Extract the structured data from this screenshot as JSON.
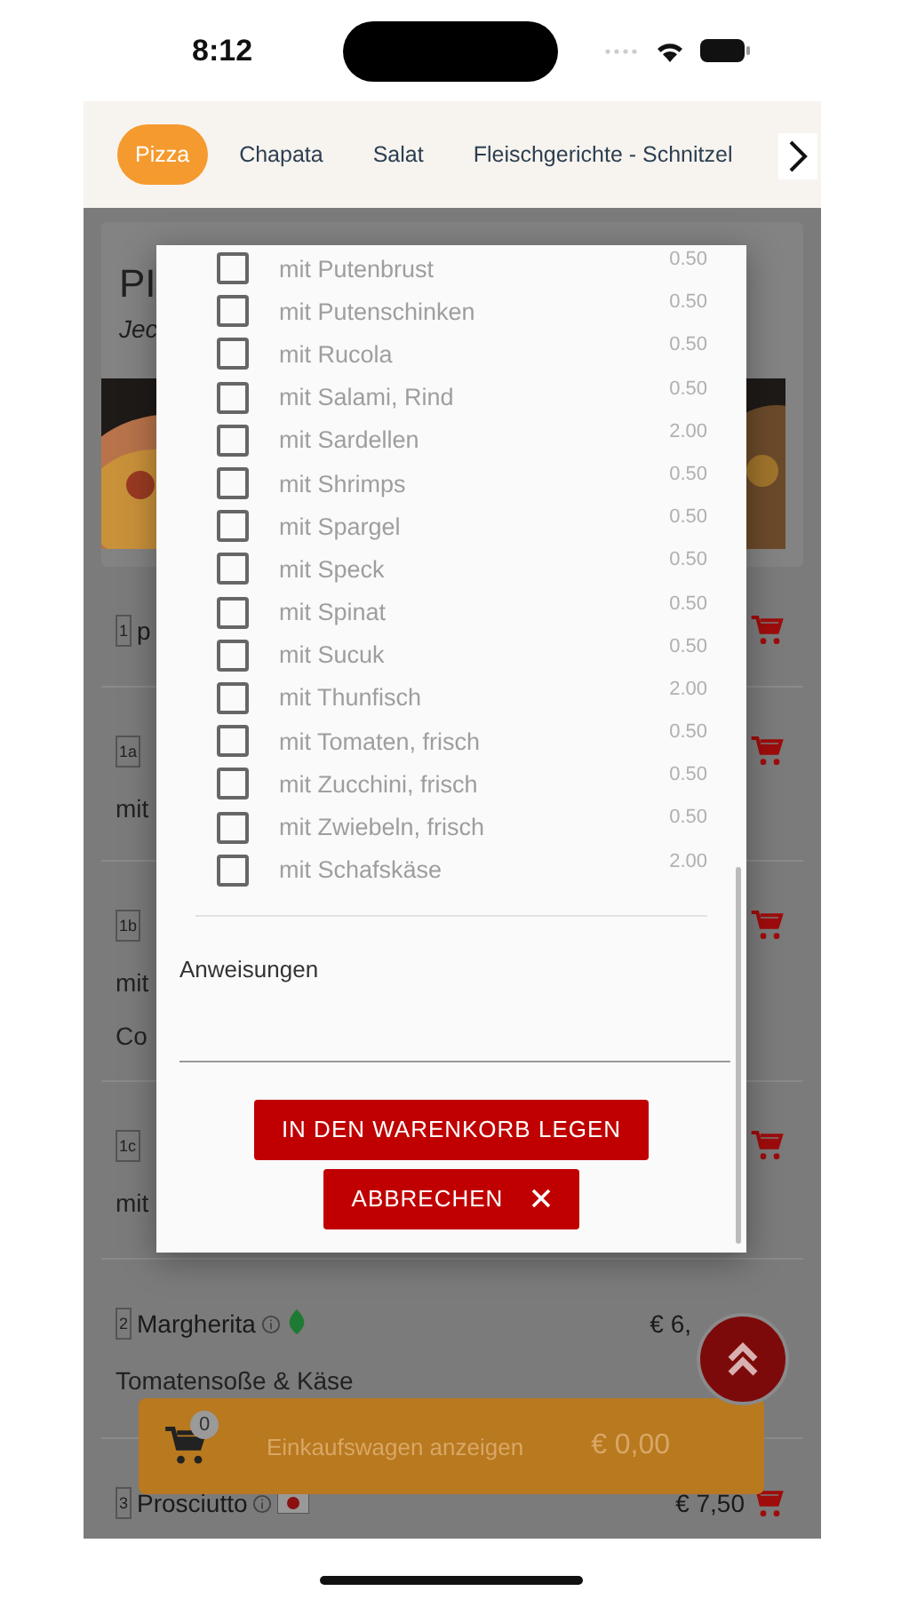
{
  "status_bar": {
    "time": "8:12"
  },
  "tabs": [
    {
      "label": "Pizza",
      "selected": true
    },
    {
      "label": "Chapata",
      "selected": false
    },
    {
      "label": "Salat",
      "selected": false
    },
    {
      "label": "Fleischgerichte - Schnitzel",
      "selected": false
    }
  ],
  "menu": {
    "title": "PI",
    "subtitle": "Jec",
    "items": [
      {
        "code": "1",
        "name": "p",
        "cart": true
      },
      {
        "code": "1a",
        "lines": [
          "mit"
        ],
        "cart": true
      },
      {
        "code": "1b",
        "lines": [
          "mit",
          "Co"
        ],
        "cart": true
      },
      {
        "code": "1c",
        "lines": [
          "mit"
        ],
        "cart": true
      },
      {
        "code": "2",
        "name": "Margherita",
        "price": "€ 6,",
        "lines": [
          "Tomatensoße & Käse"
        ],
        "leaf": true,
        "flag": false,
        "cart": false
      },
      {
        "code": "3",
        "name": "Prosciutto",
        "price": "€ 7,50",
        "leaf": false,
        "flag": true,
        "cart": true
      }
    ]
  },
  "extras_dialog": {
    "options": [
      {
        "label": "mit Putenbrust",
        "price": "0.50",
        "checked": false
      },
      {
        "label": "mit Putenschinken",
        "price": "0.50",
        "checked": false
      },
      {
        "label": "mit Rucola",
        "price": "0.50",
        "checked": false
      },
      {
        "label": "mit Salami, Rind",
        "price": "0.50",
        "checked": false
      },
      {
        "label": "mit Sardellen",
        "price": "2.00",
        "checked": false
      },
      {
        "label": "mit Shrimps",
        "price": "0.50",
        "checked": false
      },
      {
        "label": "mit Spargel",
        "price": "0.50",
        "checked": false
      },
      {
        "label": "mit Speck",
        "price": "0.50",
        "checked": false
      },
      {
        "label": "mit Spinat",
        "price": "0.50",
        "checked": false
      },
      {
        "label": "mit Sucuk",
        "price": "0.50",
        "checked": false
      },
      {
        "label": "mit Thunfisch",
        "price": "2.00",
        "checked": false
      },
      {
        "label": "mit Tomaten, frisch",
        "price": "0.50",
        "checked": false
      },
      {
        "label": "mit Zucchini, frisch",
        "price": "0.50",
        "checked": false
      },
      {
        "label": "mit Zwiebeln, frisch",
        "price": "0.50",
        "checked": false
      },
      {
        "label": "mit Schafskäse",
        "price": "2.00",
        "checked": false
      }
    ],
    "instructions_label": "Anweisungen",
    "add_button": "IN DEN WARENKORB LEGEN",
    "cancel_button": "ABBRECHEN"
  },
  "cart_bar": {
    "count": "0",
    "label": "Einkaufswagen anzeigen",
    "total": "€ 0,00"
  }
}
